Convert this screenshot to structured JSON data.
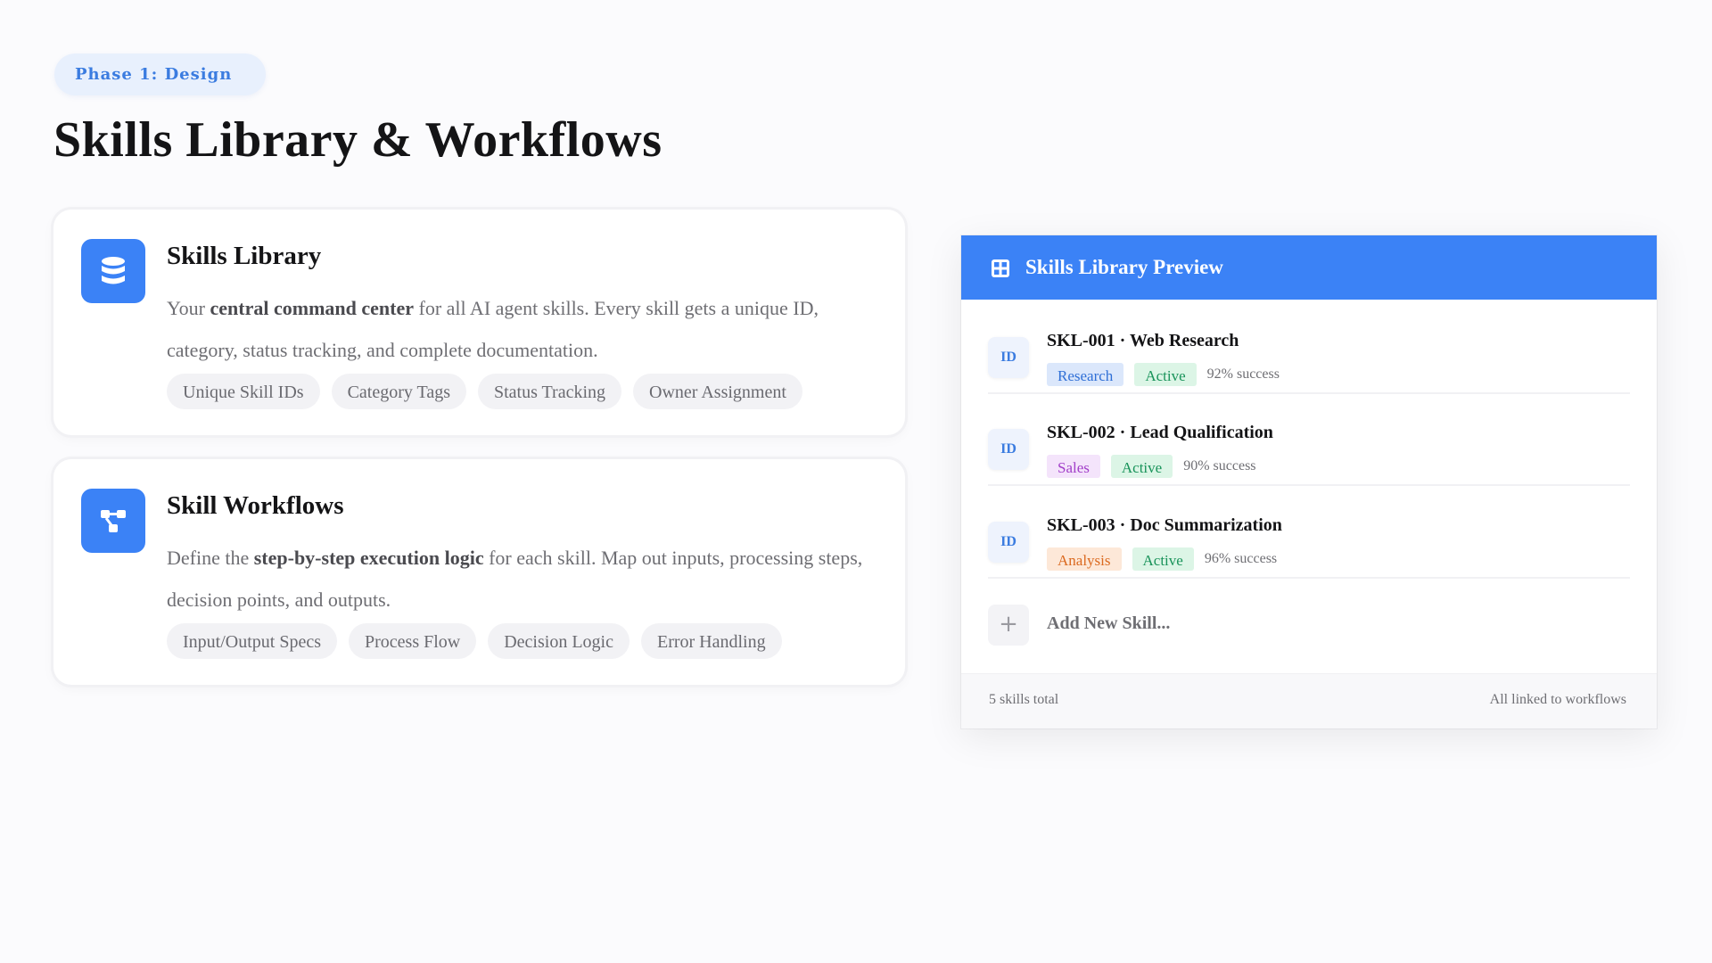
{
  "phase_badge": "Phase 1: Design",
  "page_title": "Skills Library & Workflows",
  "cards": [
    {
      "icon": "database-icon",
      "title": "Skills Library",
      "desc_pre": "Your ",
      "desc_bold": "central command center",
      "desc_post": " for all AI agent skills. Every skill gets a unique ID, category, status tracking, and complete documentation.",
      "tags": [
        "Unique Skill IDs",
        "Category Tags",
        "Status Tracking",
        "Owner Assignment"
      ]
    },
    {
      "icon": "workflow-icon",
      "title": "Skill Workflows",
      "desc_pre": "Define the ",
      "desc_bold": "step-by-step execution logic",
      "desc_post": " for each skill. Map out inputs, processing steps, decision points, and outputs.",
      "tags": [
        "Input/Output Specs",
        "Process Flow",
        "Decision Logic",
        "Error Handling"
      ]
    }
  ],
  "preview": {
    "icon": "grid-icon",
    "title": "Skills Library Preview",
    "skills": [
      {
        "badge": "ID",
        "name": "SKL-001 · Web Research",
        "category": "Research",
        "status": "Active",
        "success": "92% success"
      },
      {
        "badge": "ID",
        "name": "SKL-002 · Lead Qualification",
        "category": "Sales",
        "status": "Active",
        "success": "90% success"
      },
      {
        "badge": "ID",
        "name": "SKL-003 · Doc Summarization",
        "category": "Analysis",
        "status": "Active",
        "success": "96% success"
      }
    ],
    "add_icon": "+",
    "add_label": "Add New Skill...",
    "footer_left": "5 skills total",
    "footer_right": "All linked to workflows"
  },
  "colors": {
    "accent": "#3b82f6",
    "research": "#2f6fd6",
    "sales": "#a23fc9",
    "analysis": "#db6a20",
    "active": "#19935a"
  }
}
